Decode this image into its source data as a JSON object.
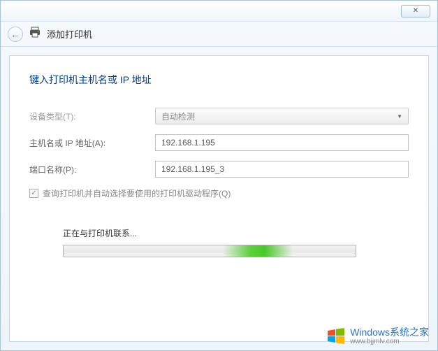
{
  "titlebar": {
    "close_symbol": "✕"
  },
  "header": {
    "back_symbol": "←",
    "title": "添加打印机"
  },
  "page": {
    "title": "键入打印机主机名或 IP 地址"
  },
  "form": {
    "device_type_label": "设备类型(T):",
    "device_type_value": "自动检测",
    "hostname_label": "主机名或 IP 地址(A):",
    "hostname_value": "192.168.1.195",
    "port_label": "端口名称(P):",
    "port_value": "192.168.1.195_3",
    "checkbox_label": "查询打印机并自动选择要使用的打印机驱动程序(Q)",
    "checkbox_checked": "✓"
  },
  "status": {
    "message": "正在与打印机联系..."
  },
  "watermark": {
    "brand_en": "Windows",
    "brand_cn": "系统之家",
    "url": "www.bjjmlv.com"
  }
}
